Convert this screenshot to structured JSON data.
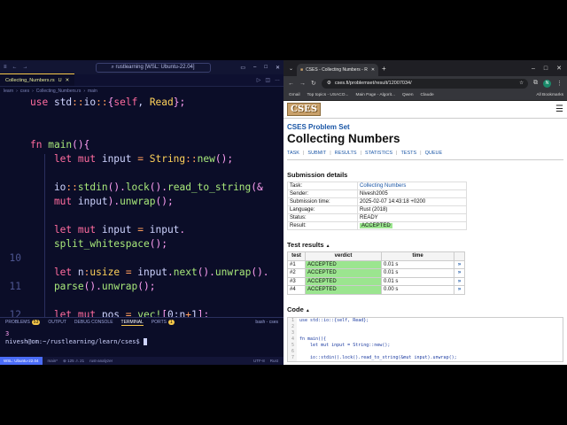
{
  "vscode": {
    "window_title": "rustlearning [WSL: Ubuntu-22.04]",
    "tab": {
      "label": "Collecting_Numbers.rs",
      "flag": "U"
    },
    "breadcrumb": [
      "learn",
      "cses",
      "Collecting_Numbers.rs",
      "main"
    ],
    "code_lines": [
      {
        "n": "",
        "tokens": [
          {
            "t": "use ",
            "c": "kw"
          },
          {
            "t": "std",
            "c": ""
          },
          {
            "t": "::",
            "c": "op"
          },
          {
            "t": "io",
            "c": ""
          },
          {
            "t": "::",
            "c": "op"
          },
          {
            "t": "{",
            "c": "pu"
          },
          {
            "t": "self",
            "c": "kw"
          },
          {
            "t": ", ",
            "c": ""
          },
          {
            "t": "Read",
            "c": "ty"
          },
          {
            "t": "};",
            "c": "pu"
          }
        ]
      },
      {
        "n": "",
        "tokens": []
      },
      {
        "n": "",
        "tokens": []
      },
      {
        "n": "",
        "tokens": [
          {
            "t": "fn ",
            "c": "kw"
          },
          {
            "t": "main",
            "c": "fn"
          },
          {
            "t": "(){",
            "c": "pu"
          }
        ]
      },
      {
        "n": "",
        "tokens": [
          {
            "t": "    let mut ",
            "c": "kw"
          },
          {
            "t": "input ",
            "c": ""
          },
          {
            "t": "= ",
            "c": "op"
          },
          {
            "t": "String",
            "c": "ty"
          },
          {
            "t": "::",
            "c": "op"
          },
          {
            "t": "new",
            "c": "fn"
          },
          {
            "t": "();",
            "c": "pu"
          }
        ]
      },
      {
        "n": "",
        "tokens": []
      },
      {
        "n": "",
        "tokens": [
          {
            "t": "    io",
            "c": ""
          },
          {
            "t": "::",
            "c": "op"
          },
          {
            "t": "stdin",
            "c": "fn"
          },
          {
            "t": "().",
            "c": "pu"
          },
          {
            "t": "lock",
            "c": "fn"
          },
          {
            "t": "().",
            "c": "pu"
          },
          {
            "t": "read_to_string",
            "c": "fn"
          },
          {
            "t": "(&",
            "c": "pu"
          }
        ]
      },
      {
        "n": "",
        "tokens": [
          {
            "t": "    mut ",
            "c": "kw"
          },
          {
            "t": "input",
            "c": ""
          },
          {
            "t": ").",
            "c": "pu"
          },
          {
            "t": "unwrap",
            "c": "fn"
          },
          {
            "t": "();",
            "c": "pu"
          }
        ]
      },
      {
        "n": "",
        "tokens": []
      },
      {
        "n": "",
        "tokens": [
          {
            "t": "    let mut ",
            "c": "kw"
          },
          {
            "t": "input ",
            "c": ""
          },
          {
            "t": "= ",
            "c": "op"
          },
          {
            "t": "input",
            "c": ""
          },
          {
            "t": ".",
            "c": "pu"
          }
        ]
      },
      {
        "n": "",
        "tokens": [
          {
            "t": "    split_whitespace",
            "c": "fn"
          },
          {
            "t": "();",
            "c": "pu"
          }
        ]
      },
      {
        "n": "10",
        "tokens": []
      },
      {
        "n": "",
        "tokens": [
          {
            "t": "    let ",
            "c": "kw"
          },
          {
            "t": "n",
            "c": ""
          },
          {
            "t": ":",
            "c": "op"
          },
          {
            "t": "usize ",
            "c": "ty"
          },
          {
            "t": "= ",
            "c": "op"
          },
          {
            "t": "input",
            "c": ""
          },
          {
            "t": ".",
            "c": "pu"
          },
          {
            "t": "next",
            "c": "fn"
          },
          {
            "t": "().",
            "c": "pu"
          },
          {
            "t": "unwrap",
            "c": "fn"
          },
          {
            "t": "().",
            "c": "pu"
          }
        ]
      },
      {
        "n": "11",
        "tokens": [
          {
            "t": "    parse",
            "c": "fn"
          },
          {
            "t": "().",
            "c": "pu"
          },
          {
            "t": "unwrap",
            "c": "fn"
          },
          {
            "t": "();",
            "c": "pu"
          }
        ]
      },
      {
        "n": "",
        "tokens": []
      },
      {
        "n": "12",
        "tokens": [
          {
            "t": "    let mut ",
            "c": "kw"
          },
          {
            "t": "pos ",
            "c": ""
          },
          {
            "t": "= ",
            "c": "op"
          },
          {
            "t": "vec!",
            "c": "fn"
          },
          {
            "t": "[",
            "c": "pu"
          },
          {
            "t": "0",
            "c": ""
          },
          {
            "t": ";",
            "c": ""
          },
          {
            "t": "n",
            "c": ""
          },
          {
            "t": "+",
            "c": "op"
          },
          {
            "t": "1",
            "c": ""
          },
          {
            "t": "];",
            "c": "pu"
          }
        ]
      }
    ],
    "panel_tabs": [
      "PROBLEMS",
      "OUTPUT",
      "DEBUG CONSOLE",
      "TERMINAL",
      "PORTS"
    ],
    "problems_count": "53",
    "ports_count": "1",
    "terminal_session": "bash - cses",
    "terminal_lines": [
      "3",
      "nivesh@om:~/rustlearning/learn/cses$ "
    ],
    "status": {
      "remote": "WSL: Ubuntu-22.04",
      "branch": "main*",
      "errors": "125",
      "warnings": "21",
      "analyzer": "rust-analyzer",
      "encoding": "UTF-8",
      "lang": "Rust"
    }
  },
  "chrome": {
    "tab_title": "CSES - Collecting Numbers - R",
    "url": "cses.fi/problemset/result/12007034/",
    "bookmarks": [
      "Gmail",
      "Top topics - USACO...",
      "Main Page - Algorit...",
      "Qwen",
      "Claude"
    ],
    "all_bookmarks": "All Bookmarks"
  },
  "page": {
    "logo": "CSES",
    "problem_set": "CSES Problem Set",
    "title": "Collecting Numbers",
    "nav": [
      "TASK",
      "SUBMIT",
      "RESULTS",
      "STATISTICS",
      "TESTS",
      "QUEUE"
    ],
    "details_heading": "Submission details",
    "details": [
      {
        "k": "Task:",
        "v": "Collecting Numbers"
      },
      {
        "k": "Sender:",
        "v": "Nivesh2005"
      },
      {
        "k": "Submission time:",
        "v": "2025-02-07 14:43:18 +0200"
      },
      {
        "k": "Language:",
        "v": "Rust (2018)"
      },
      {
        "k": "Status:",
        "v": "READY"
      },
      {
        "k": "Result:",
        "v": "ACCEPTED"
      }
    ],
    "results_heading": "Test results",
    "results_cols": [
      "test",
      "verdict",
      "time"
    ],
    "results": [
      {
        "test": "#1",
        "verdict": "ACCEPTED",
        "time": "0.01 s"
      },
      {
        "test": "#2",
        "verdict": "ACCEPTED",
        "time": "0.01 s"
      },
      {
        "test": "#3",
        "verdict": "ACCEPTED",
        "time": "0.01 s"
      },
      {
        "test": "#4",
        "verdict": "ACCEPTED",
        "time": "0.00 s"
      }
    ],
    "code_heading": "Code",
    "code_lines": [
      "use std::io::{self, Read};",
      "",
      "",
      "fn main(){",
      "    let mut input = String::new();",
      "",
      "    io::stdin().lock().read_to_string(&mut input).unwrap();"
    ]
  }
}
